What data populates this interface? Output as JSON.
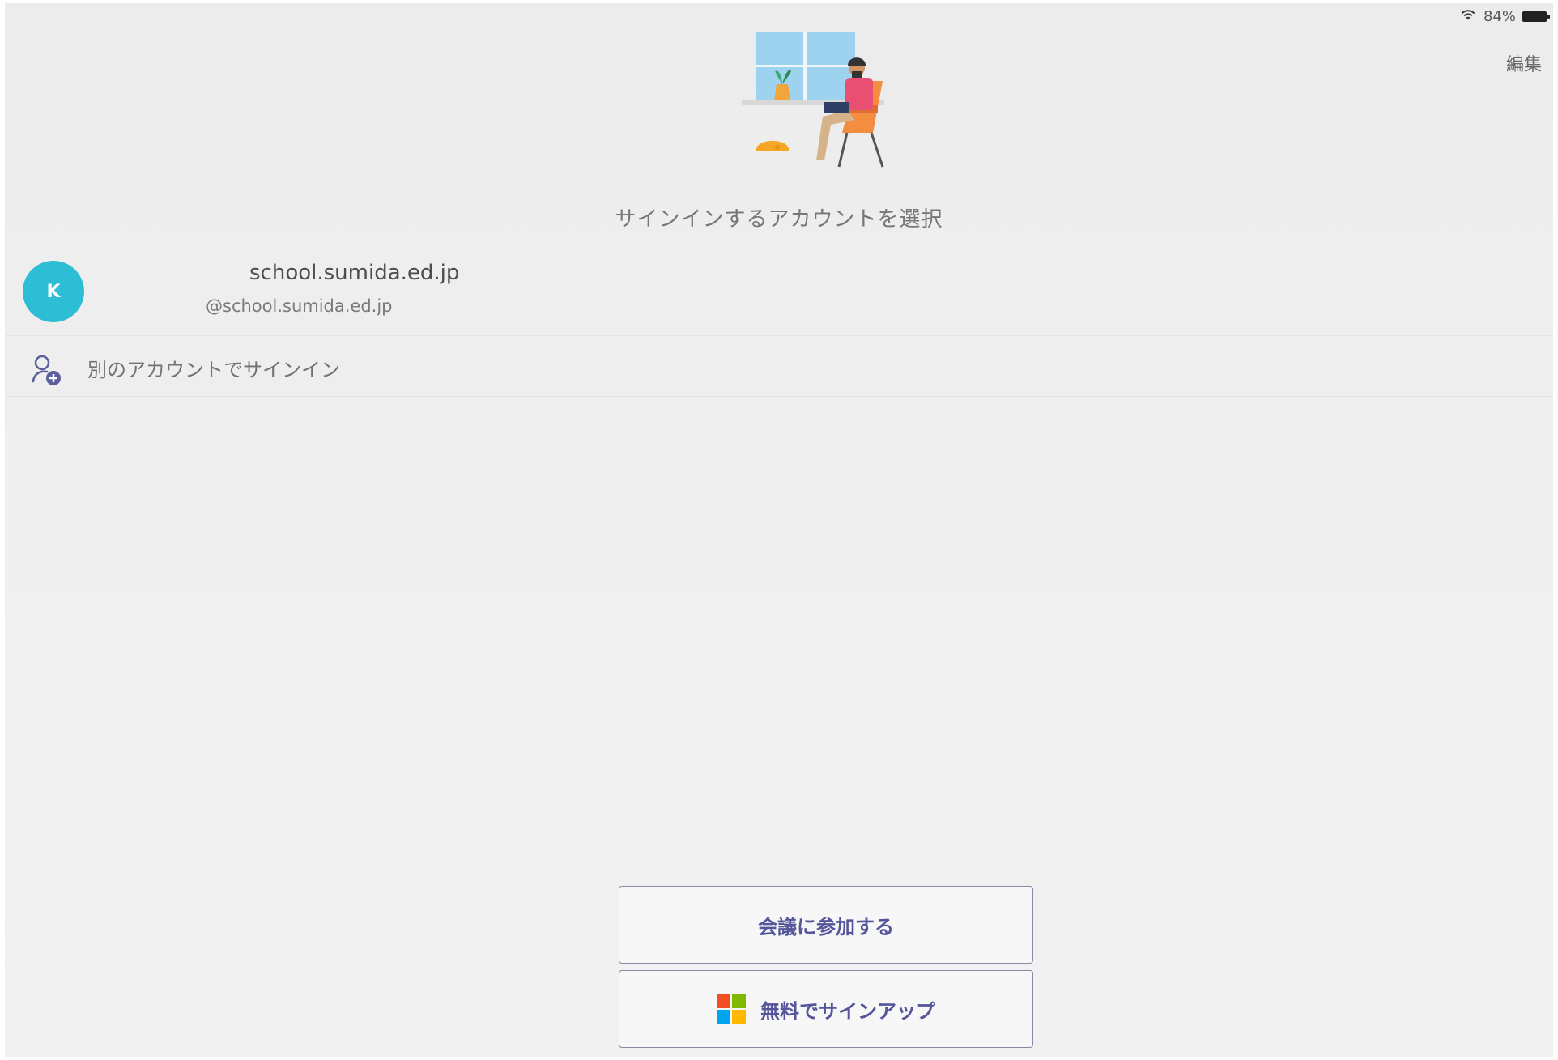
{
  "status_bar": {
    "battery": "84%"
  },
  "header": {
    "edit_label": "編集"
  },
  "main": {
    "title": "サインインするアカウントを選択",
    "account": {
      "initial": "K",
      "name": "school.sumida.ed.jp",
      "email": "@school.sumida.ed.jp"
    },
    "other_account": {
      "label": "別のアカウントでサインイン",
      "icon": "add-person-icon"
    }
  },
  "buttons": {
    "join_meeting": "会議に参加する",
    "free_signup": "無料でサインアップ"
  },
  "colors": {
    "avatar": "#2dbdd4",
    "button_text": "#55559a",
    "button_border": "#8a8aa8",
    "title": "#767676"
  }
}
